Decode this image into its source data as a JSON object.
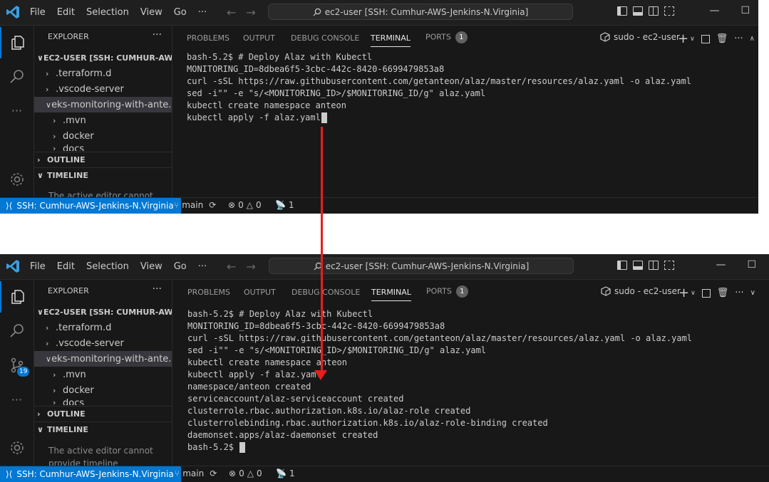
{
  "menu": [
    "File",
    "Edit",
    "Selection",
    "View",
    "Go",
    "···"
  ],
  "command_center": "ec2-user [SSH: Cumhur-AWS-Jenkins-N.Virginia]",
  "explorer": {
    "header": "EXPLORER",
    "root": "EC2-USER [SSH: CUMHUR-AWS...",
    "items": [
      ".terraform.d",
      ".vscode-server",
      "eks-monitoring-with-ante...",
      ".mvn",
      "docker",
      "docs"
    ],
    "outline": "OUTLINE",
    "timeline": "TIMELINE",
    "timeline_note_1": "The active editor cannot",
    "timeline_note_2": "provide timeline"
  },
  "panel": {
    "tabs": [
      "PROBLEMS",
      "OUTPUT",
      "DEBUG CONSOLE",
      "TERMINAL",
      "PORTS"
    ],
    "ports_count": "1",
    "terminal_title": "sudo - ec2-user"
  },
  "terminal_before": [
    "bash-5.2$ # Deploy Alaz with Kubectl",
    "MONITORING_ID=8dbea6f5-3cbc-442c-8420-6699479853a8",
    "curl -sSL https://raw.githubusercontent.com/getanteon/alaz/master/resources/alaz.yaml -o alaz.yaml",
    "sed -i\"\" -e \"s/<MONITORING_ID>/$MONITORING_ID/g\" alaz.yaml",
    "kubectl create namespace anteon",
    "kubectl apply -f alaz.yaml"
  ],
  "terminal_after": [
    "bash-5.2$ # Deploy Alaz with Kubectl",
    "MONITORING_ID=8dbea6f5-3cbc-442c-8420-6699479853a8",
    "curl -sSL https://raw.githubusercontent.com/getanteon/alaz/master/resources/alaz.yaml -o alaz.yaml",
    "sed -i\"\" -e \"s/<MONITORING_ID>/$MONITORING_ID/g\" alaz.yaml",
    "kubectl create namespace anteon",
    "kubectl apply -f alaz.yaml",
    "namespace/anteon created",
    "serviceaccount/alaz-serviceaccount created",
    "clusterrole.rbac.authorization.k8s.io/alaz-role created",
    "clusterrolebinding.rbac.authorization.k8s.io/alaz-role-binding created",
    "daemonset.apps/alaz-daemonset created",
    "bash-5.2$ "
  ],
  "status": {
    "remote": "SSH: Cumhur-AWS-Jenkins-N.Virginia",
    "branch": "main",
    "errors": "0",
    "warnings": "0",
    "ports": "1"
  },
  "scm_badge": "19",
  "colors": {
    "accent": "#0078d4",
    "arrow": "#e81d1d",
    "background": "#1f1f1f"
  }
}
